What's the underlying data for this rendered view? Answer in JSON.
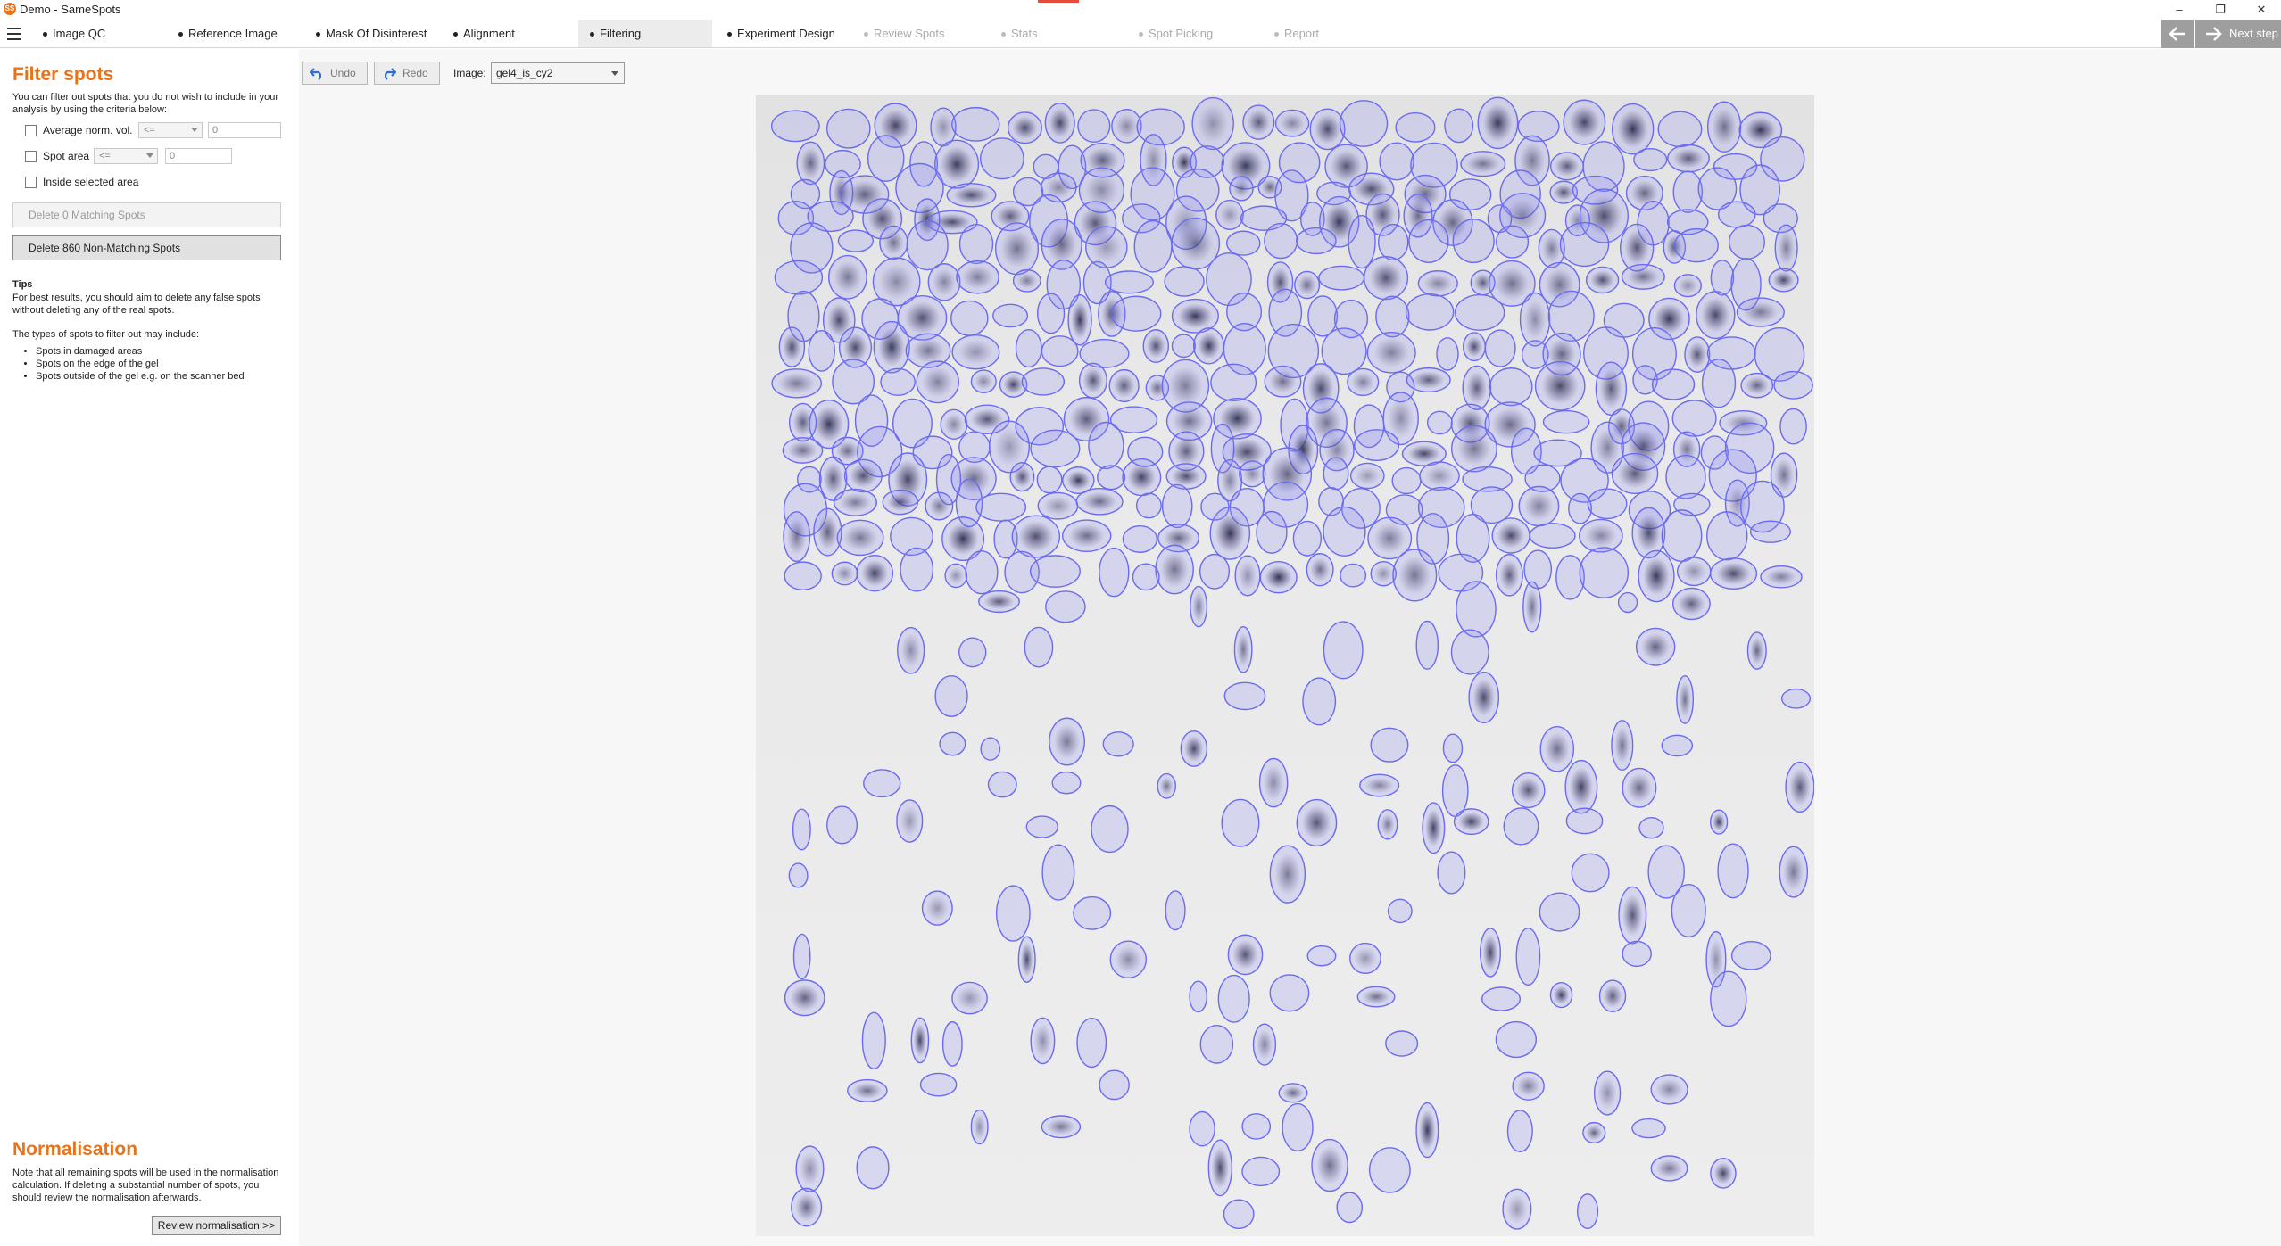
{
  "window": {
    "title": "Demo - SameSpots",
    "logo_text": "SS",
    "minimize_glyph": "–",
    "restore_glyph": "❐",
    "close_glyph": "✕"
  },
  "steps": [
    {
      "label": "Image QC",
      "state": "done"
    },
    {
      "label": "Reference Image",
      "state": "done"
    },
    {
      "label": "Mask Of Disinterest",
      "state": "done"
    },
    {
      "label": "Alignment",
      "state": "done"
    },
    {
      "label": "Filtering",
      "state": "active"
    },
    {
      "label": "Experiment Design",
      "state": "done"
    },
    {
      "label": "Review Spots",
      "state": "disabled"
    },
    {
      "label": "Stats",
      "state": "disabled"
    },
    {
      "label": "Spot Picking",
      "state": "disabled"
    },
    {
      "label": "Report",
      "state": "disabled"
    }
  ],
  "nav": {
    "next_label": "Next step"
  },
  "filter": {
    "title": "Filter spots",
    "intro": "You can filter out spots that you do not wish to include in your analysis by using the criteria below:",
    "avg_label": "Average norm. vol.",
    "avg_operator": "<=",
    "avg_value": "0",
    "area_label": "Spot area",
    "area_operator": "<=",
    "area_value": "0",
    "inside_label": "Inside selected area",
    "delete_matching": "Delete 0 Matching Spots",
    "delete_nonmatching": "Delete 860 Non-Matching Spots"
  },
  "tips": {
    "title": "Tips",
    "text1": "For best results, you should aim to delete any false spots without deleting any of the real spots.",
    "text2": "The types of spots to filter out may include:",
    "bullets": [
      "Spots in damaged areas",
      "Spots on the edge of the gel",
      "Spots outside of the gel e.g. on the scanner bed"
    ]
  },
  "normalisation": {
    "title": "Normalisation",
    "text": "Note that all remaining spots will be used in the normalisation calculation. If deleting a substantial number of spots, you should review the normalisation afterwards.",
    "button": "Review normalisation >>"
  },
  "toolbar": {
    "undo": "Undo",
    "redo": "Redo",
    "image_label": "Image:",
    "image_value": "gel4_is_cy2"
  },
  "colors": {
    "accent": "#e8731a",
    "spot_outline": "#6b6bf0",
    "spot_fill": "#8a8af5"
  }
}
